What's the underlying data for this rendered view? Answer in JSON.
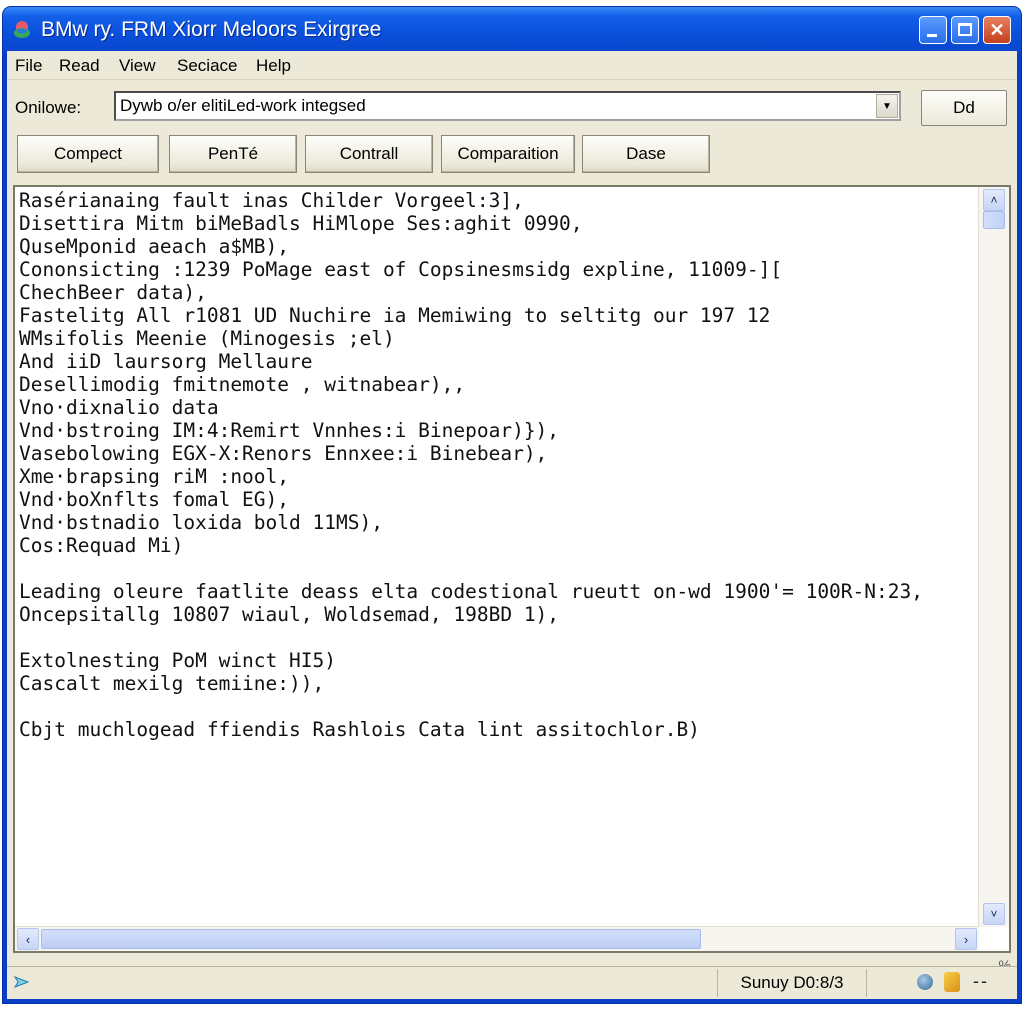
{
  "window": {
    "title": "BMw ry. FRM Xiorr Meloors Exirgree",
    "controls": {
      "minimize": "minimize",
      "maximize": "maximize",
      "close": "✕"
    }
  },
  "menu": {
    "items": [
      {
        "label": "File"
      },
      {
        "label": "Read"
      },
      {
        "label": "View"
      },
      {
        "label": "Seciace"
      },
      {
        "label": "Help"
      }
    ]
  },
  "address": {
    "label": "Onilowe:",
    "value": "Dywb o/er elitiLed-work integsed",
    "dropdown_glyph": "▼",
    "go_button": "Dd"
  },
  "toolbar": {
    "buttons": [
      {
        "label": "Compect"
      },
      {
        "label": "PenTé"
      },
      {
        "label": "Contrall"
      },
      {
        "label": "Comparaition"
      },
      {
        "label": "Dase"
      }
    ]
  },
  "editor": {
    "lines": [
      "Rasérianaing fault inas Childer Vorgeel:3],",
      "Disettira Mitm biMeBadls HiMlope Ses:aghit 0990,",
      "QuseMponid aeach a$MB),",
      "Cononsicting :1239 PoMage east of Copsinesmsidg expline, 11009-][",
      "ChechBeer data),",
      "Fastelitg All r1081 UD Nuchire ia Memiwing to seltitg our 197 12",
      "WMsifolis Meenie (Minogesis ;el)",
      "And iiD laursorg Mellaure",
      "Desellimodig fmitnemote , witnabear),,",
      "Vno·dixnalio data",
      "Vnd·bstroing IM:4:Remirt Vnnhes:i Binepoar)}),",
      "Vasebolowing EGX-X:Renors Ennxee:i Binebear),",
      "Xme·brapsing riM :nool,",
      "Vnd·boXnflts fomal EG),",
      "Vnd·bstnadio loxida bold 11MS),",
      "Cos:Requad Mi)",
      "",
      "Leading oleure faatlite deass elta codestional rueutt on-wd 1900'= 100R-N:23,",
      "Oncepsitallg 10807 wiaul, Woldsemad, 198BD 1),",
      "",
      "Extolnesting PoM winct HI5)",
      "Cascalt mexilg temiine:)),",
      "",
      "Cbjt muchlogead ffiendis Rashlois Cata lint assitochlor.B)"
    ],
    "vscroll": {
      "up": "˄",
      "down": "˅",
      "position": 0.0
    },
    "hscroll": {
      "left": "‹",
      "right": "›",
      "position": 0.0,
      "visible_fraction": 0.69
    }
  },
  "status": {
    "pane_text": "Sunuy D0:8/3",
    "grip": "%",
    "tray_dash": "--"
  }
}
